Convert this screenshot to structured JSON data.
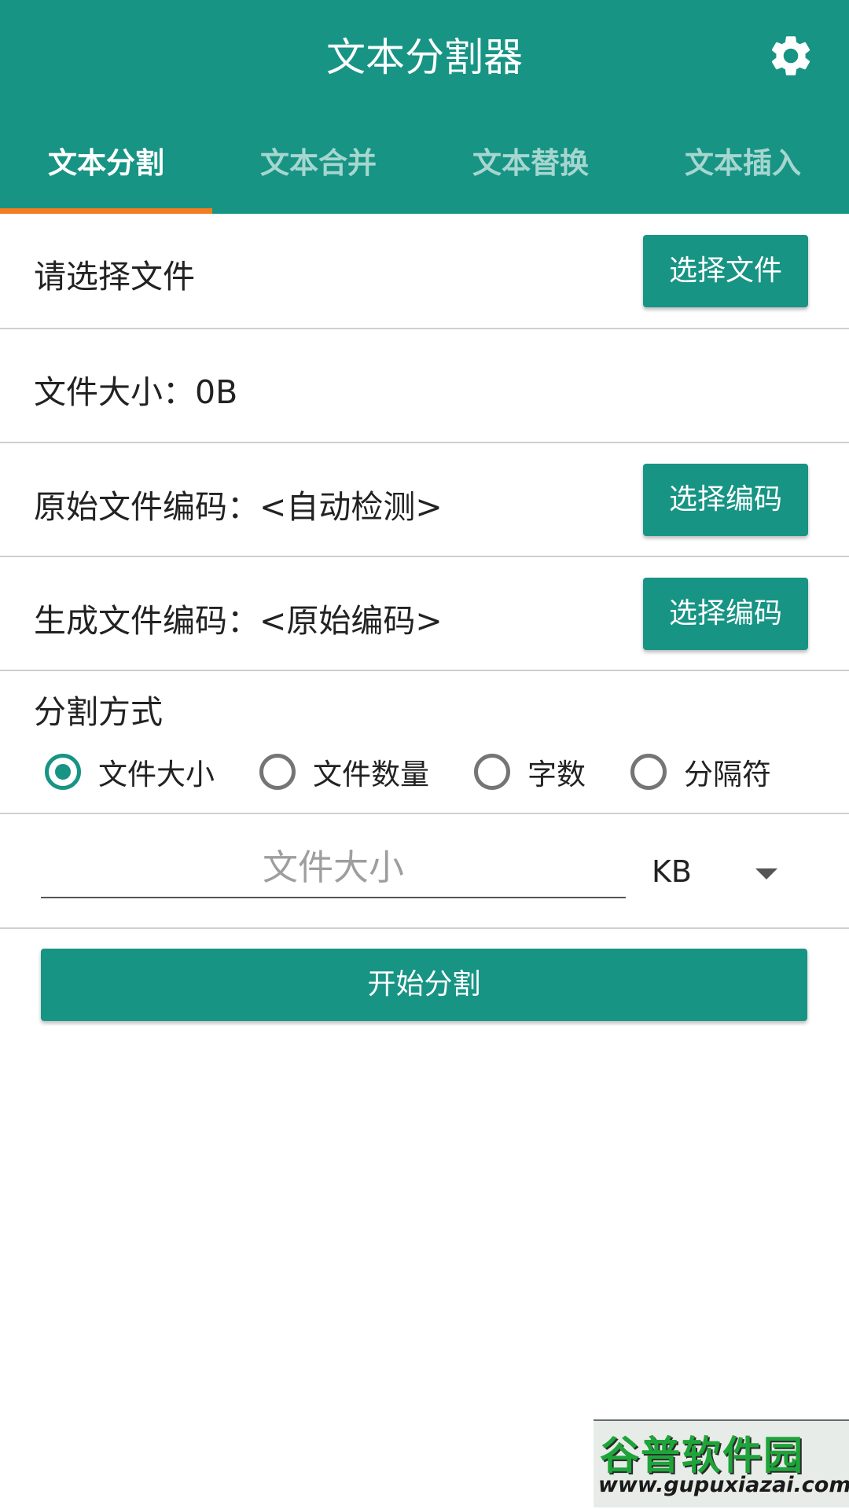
{
  "app": {
    "title": "文本分割器",
    "settings_icon": "gear-icon"
  },
  "tabs": [
    {
      "label": "文本分割",
      "active": true
    },
    {
      "label": "文本合并",
      "active": false
    },
    {
      "label": "文本替换",
      "active": false
    },
    {
      "label": "文本插入",
      "active": false
    }
  ],
  "file_row": {
    "label": "请选择文件",
    "button_label": "选择文件"
  },
  "size_row": {
    "label": "文件大小：0B"
  },
  "source_encoding_row": {
    "label": "原始文件编码：<自动检测>",
    "button_label": "选择编码"
  },
  "output_encoding_row": {
    "label": "生成文件编码：<原始编码>",
    "button_label": "选择编码"
  },
  "split_mode": {
    "title": "分割方式",
    "options": [
      {
        "label": "文件大小",
        "checked": true
      },
      {
        "label": "文件数量",
        "checked": false
      },
      {
        "label": "字数",
        "checked": false
      },
      {
        "label": "分隔符",
        "checked": false
      }
    ]
  },
  "size_input": {
    "placeholder": "文件大小",
    "value": "",
    "unit": "KB"
  },
  "start_button": {
    "label": "开始分割"
  },
  "watermark": {
    "brand": "谷普软件园",
    "url": "www.gupuxiazai.com"
  },
  "colors": {
    "primary": "#179484",
    "tab_indicator": "#f57c1f",
    "divider": "#cfcfcf"
  }
}
